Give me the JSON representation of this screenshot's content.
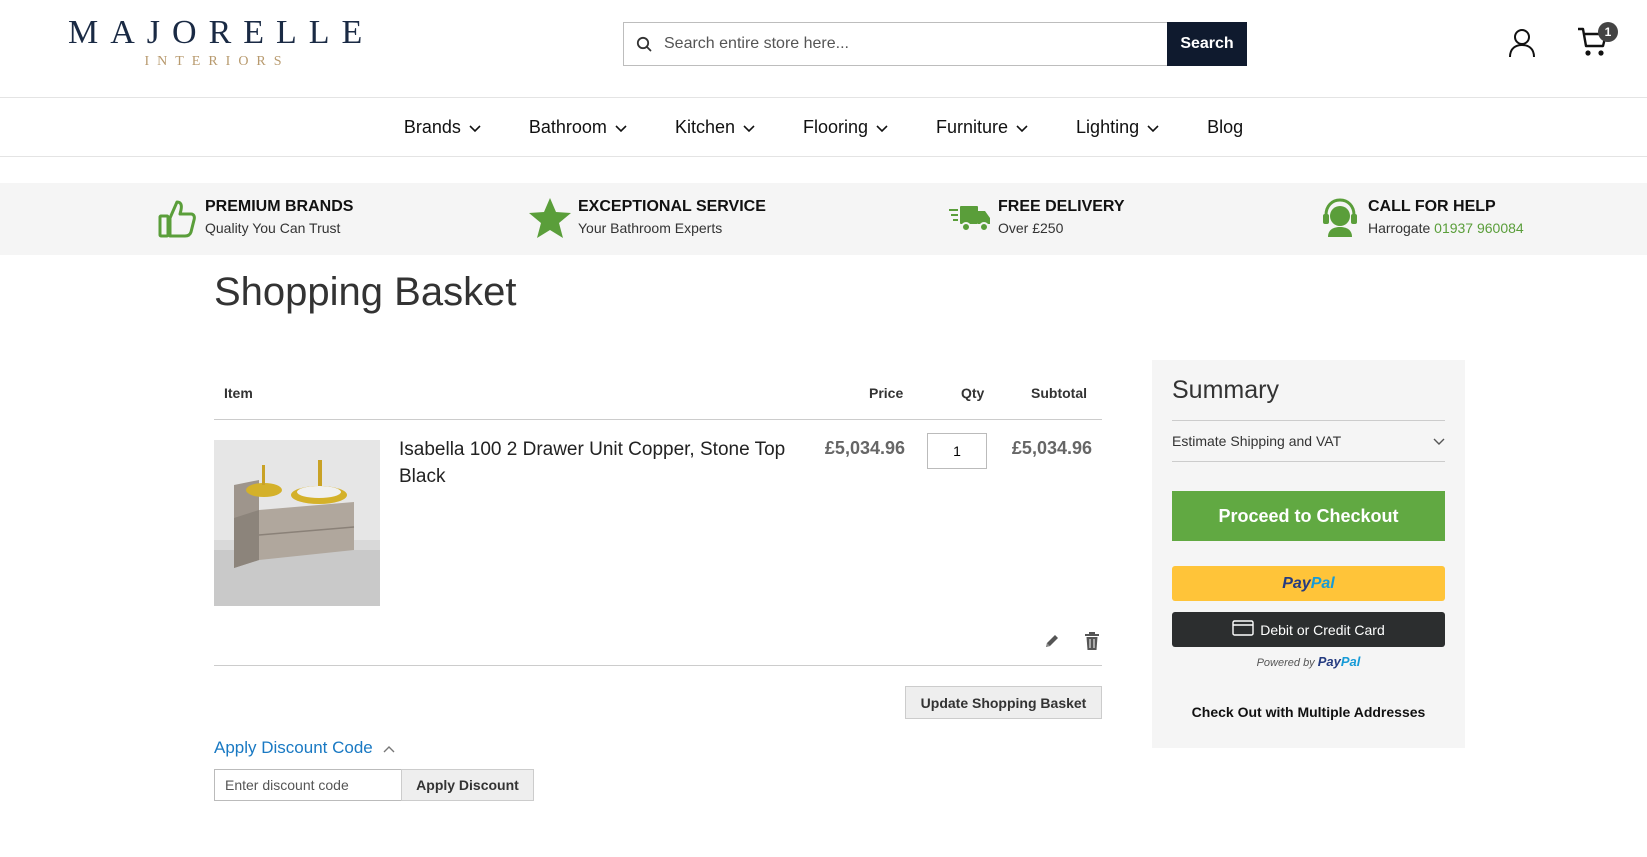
{
  "header": {
    "logo_main": "MAJORELLE",
    "logo_sub": "INTERIORS",
    "search_placeholder": "Search entire store here...",
    "search_button": "Search",
    "cart_count": "1"
  },
  "nav": {
    "items": [
      {
        "label": "Brands",
        "dropdown": true
      },
      {
        "label": "Bathroom",
        "dropdown": true
      },
      {
        "label": "Kitchen",
        "dropdown": true
      },
      {
        "label": "Flooring",
        "dropdown": true
      },
      {
        "label": "Furniture",
        "dropdown": true
      },
      {
        "label": "Lighting",
        "dropdown": true
      },
      {
        "label": "Blog",
        "dropdown": false
      }
    ]
  },
  "usp": {
    "items": [
      {
        "title": "PREMIUM BRANDS",
        "sub": "Quality You Can Trust",
        "icon": "thumbs-up-icon"
      },
      {
        "title": "EXCEPTIONAL SERVICE",
        "sub": "Your Bathroom Experts",
        "icon": "star-icon"
      },
      {
        "title": "FREE DELIVERY",
        "sub": "Over £250",
        "icon": "delivery-truck-icon"
      },
      {
        "title": "CALL FOR HELP",
        "sub": "Harrogate",
        "phone": "01937 960084",
        "icon": "headset-icon"
      }
    ],
    "accent_color": "#5a9e3a"
  },
  "page_title": "Shopping Basket",
  "cart": {
    "headers": {
      "item": "Item",
      "price": "Price",
      "qty": "Qty",
      "subtotal": "Subtotal"
    },
    "items": [
      {
        "name": "Isabella 100 2 Drawer Unit Copper, Stone Top Black",
        "price": "£5,034.96",
        "qty": "1",
        "subtotal": "£5,034.96"
      }
    ],
    "update_button": "Update Shopping Basket"
  },
  "discount": {
    "toggle_label": "Apply Discount Code",
    "input_placeholder": "Enter discount code",
    "apply_button": "Apply Discount"
  },
  "summary": {
    "title": "Summary",
    "shipping_label": "Estimate Shipping and VAT",
    "checkout_button": "Proceed to Checkout",
    "paypal_label_a": "Pay",
    "paypal_label_b": "Pal",
    "card_button": "Debit or Credit Card",
    "powered_by": "Powered by",
    "powered_logo_a": "Pay",
    "powered_logo_b": "Pal",
    "multi_address": "Check Out with Multiple Addresses",
    "checkout_color": "#61a942"
  }
}
